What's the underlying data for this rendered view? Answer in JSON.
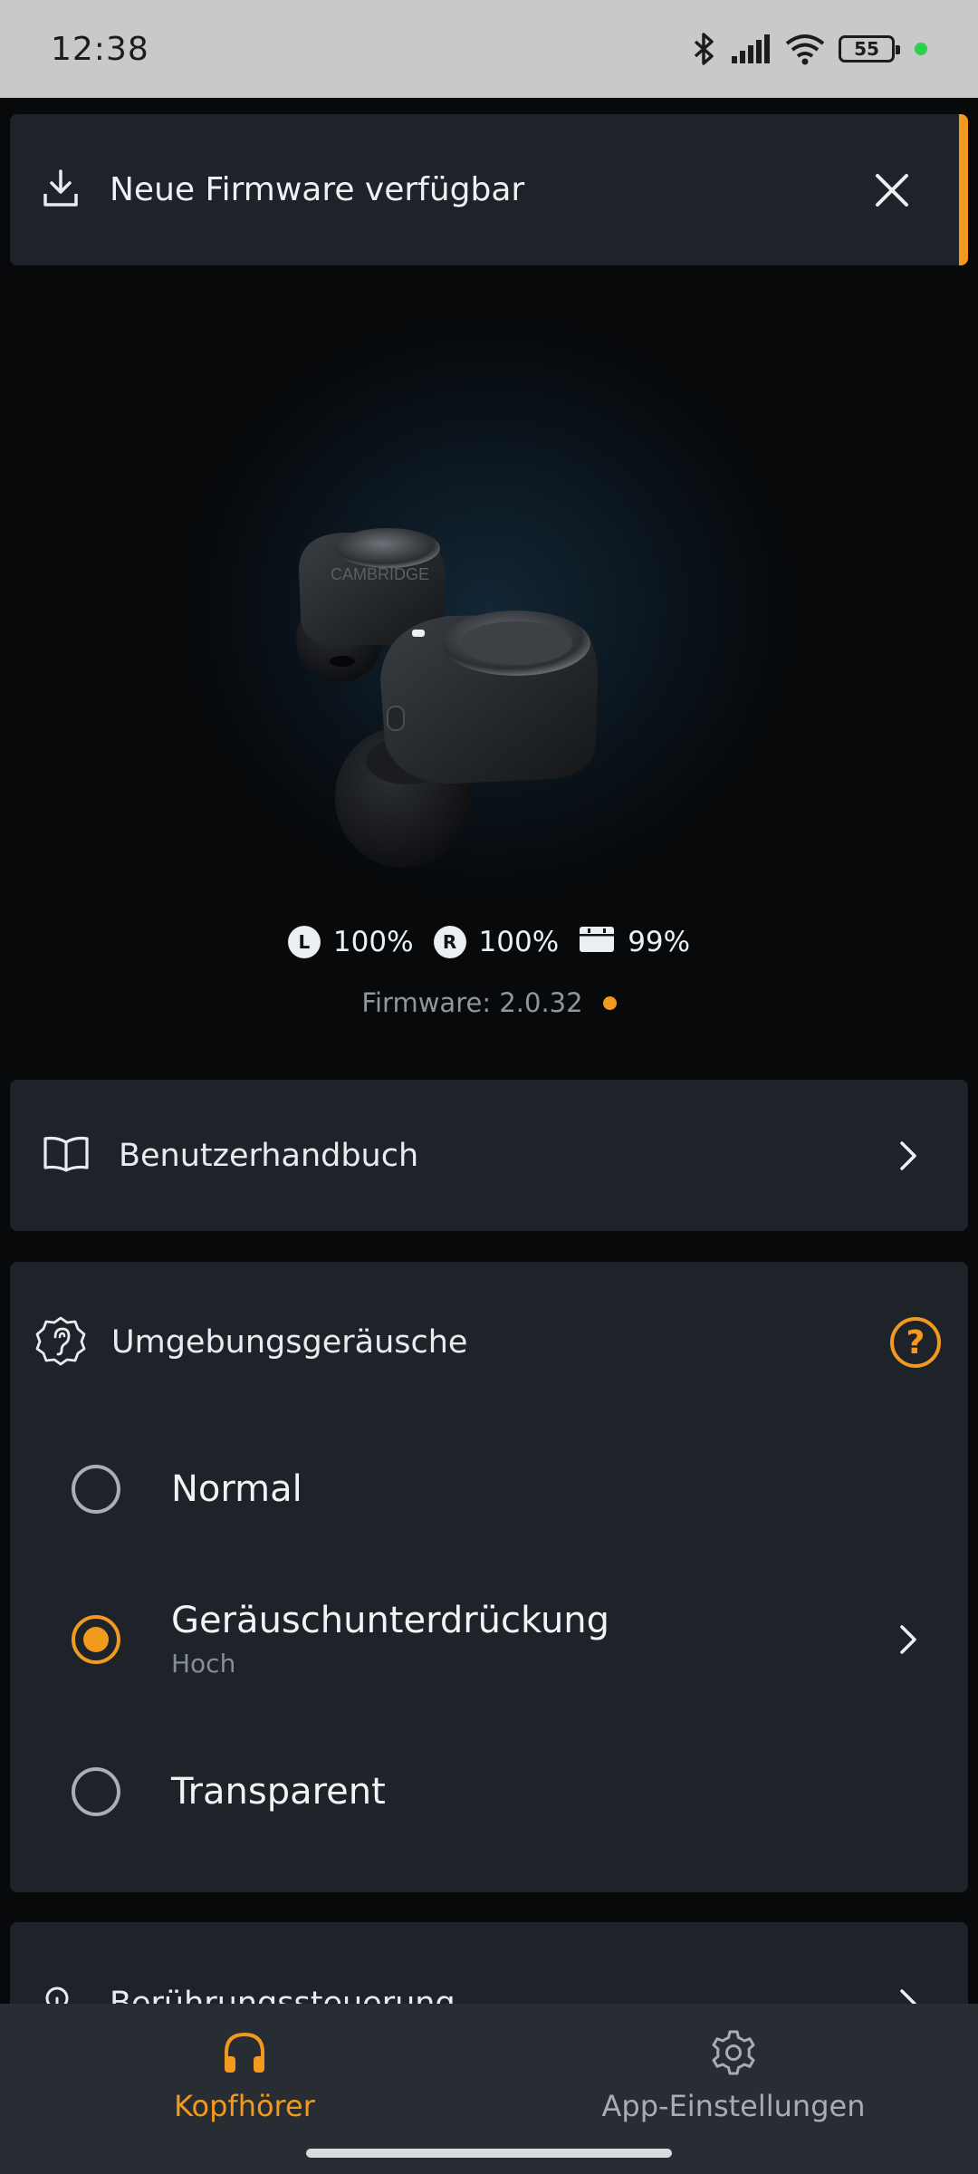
{
  "status_bar": {
    "time": "12:38",
    "battery": "55"
  },
  "firmware_banner": {
    "label": "Neue Firmware verfügbar"
  },
  "device": {
    "brand_text": "CAMBRIDGE",
    "left": {
      "badge": "L",
      "value": "100%"
    },
    "right": {
      "badge": "R",
      "value": "100%"
    },
    "case": {
      "value": "99%"
    },
    "firmware": "Firmware: 2.0.32"
  },
  "manual": {
    "label": "Benutzerhandbuch"
  },
  "ambient": {
    "label": "Umgebungsgeräusche",
    "help": "?",
    "modes": [
      {
        "title": "Normal",
        "selected": false
      },
      {
        "title": "Geräuschunterdrückung",
        "subtitle": "Hoch",
        "selected": true
      },
      {
        "title": "Transparent",
        "selected": false
      }
    ]
  },
  "touch": {
    "label": "Berührungssteuerung"
  },
  "nav": {
    "headphones": "Kopfhörer",
    "settings": "App-Einstellungen"
  },
  "colors": {
    "accent": "#f29a1d",
    "card": "#1e232a",
    "background": "#07090b"
  }
}
